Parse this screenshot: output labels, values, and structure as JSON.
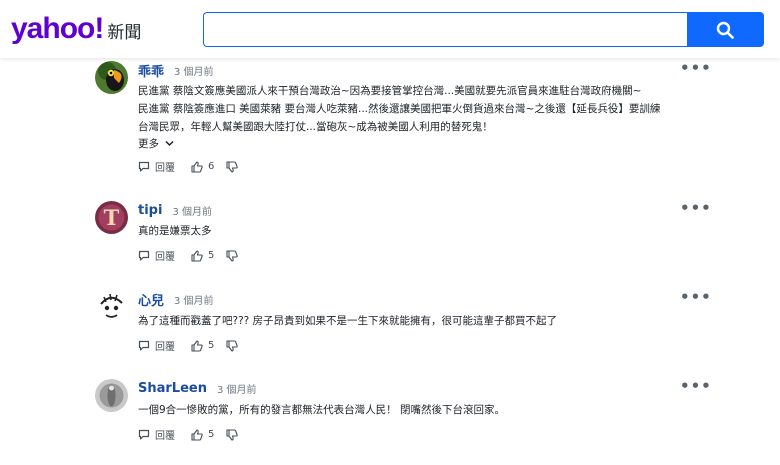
{
  "header": {
    "logo_text": "yahoo!",
    "section_text": "新聞",
    "search_placeholder": "",
    "search_icon": "search-icon"
  },
  "comments": [
    {
      "author": "乖乖",
      "time": "3 個月前",
      "lines": [
        "民進黨 蔡陰文簽應美國派人來干預台灣政治~因為要接管掌控台灣...美國就要先派官員來進駐台灣政府機關~",
        "民進黨 蔡陰簽應進口 美國萊豬 要台灣人吃萊豬...然後還讓美國把軍火倒貨過來台灣~之後還【延長兵役】要訓練",
        "台灣民眾，年輕人幫美國跟大陸打仗...當砲灰~成為被美國人利用的替死鬼！"
      ],
      "show_more": "更多",
      "reply_label": "回覆",
      "upvotes": "6"
    },
    {
      "author": "tipi",
      "time": "3 個月前",
      "lines": [
        "真的是嫌票太多"
      ],
      "reply_label": "回覆",
      "upvotes": "5"
    },
    {
      "author": "心兒",
      "time": "3 個月前",
      "lines": [
        "為了這種而戳蓋了吧??? 房子昂貴到如果不是一生下來就能擁有，很可能這輩子都買不起了"
      ],
      "reply_label": "回覆",
      "upvotes": "5"
    },
    {
      "author": "SharLeen",
      "time": "3 個月前",
      "lines": [
        "一個9合一慘敗的黨，所有的發言都無法代表台灣人民！ 閉嘴然後下台滾回家。"
      ],
      "reply_label": "回覆",
      "upvotes": "5"
    }
  ],
  "colors": {
    "brand": "#6001d2",
    "search_button": "#0f69ff",
    "author": "#1a4da1"
  }
}
